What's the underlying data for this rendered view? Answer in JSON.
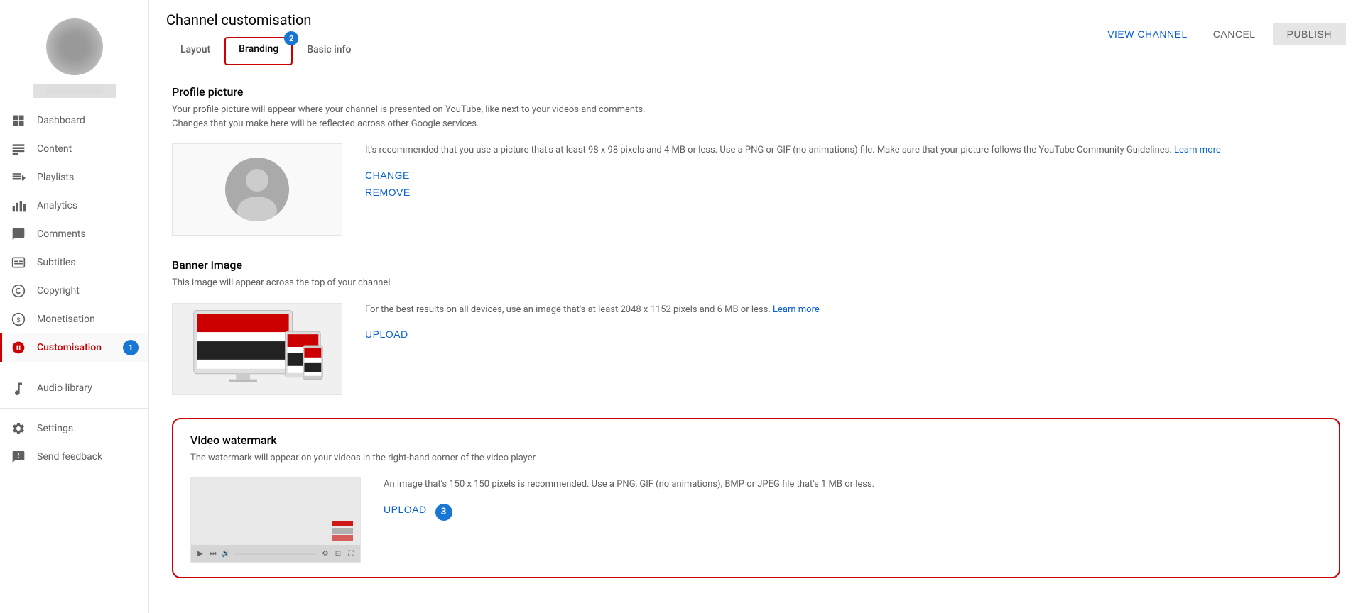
{
  "sidebar": {
    "avatar_name": "",
    "nav_items": [
      {
        "id": "dashboard",
        "label": "Dashboard",
        "icon": "dashboard",
        "active": false
      },
      {
        "id": "content",
        "label": "Content",
        "icon": "content",
        "active": false
      },
      {
        "id": "playlists",
        "label": "Playlists",
        "icon": "playlists",
        "active": false
      },
      {
        "id": "analytics",
        "label": "Analytics",
        "icon": "analytics",
        "active": false
      },
      {
        "id": "comments",
        "label": "Comments",
        "icon": "comments",
        "active": false
      },
      {
        "id": "subtitles",
        "label": "Subtitles",
        "icon": "subtitles",
        "active": false
      },
      {
        "id": "copyright",
        "label": "Copyright",
        "icon": "copyright",
        "active": false
      },
      {
        "id": "monetisation",
        "label": "Monetisation",
        "icon": "monetisation",
        "active": false
      },
      {
        "id": "customisation",
        "label": "Customisation",
        "icon": "customisation",
        "active": true
      }
    ],
    "bottom_items": [
      {
        "id": "audio-library",
        "label": "Audio library",
        "icon": "audio"
      },
      {
        "id": "settings",
        "label": "Settings",
        "icon": "settings"
      },
      {
        "id": "send-feedback",
        "label": "Send feedback",
        "icon": "feedback"
      }
    ]
  },
  "page": {
    "title": "Channel customisation",
    "tabs": [
      {
        "id": "layout",
        "label": "Layout",
        "active": false
      },
      {
        "id": "branding",
        "label": "Branding",
        "active": true
      },
      {
        "id": "basic-info",
        "label": "Basic info",
        "active": false
      }
    ],
    "actions": {
      "view_channel": "VIEW CHANNEL",
      "cancel": "CANCEL",
      "publish": "PUBLISH"
    }
  },
  "sections": {
    "profile_picture": {
      "title": "Profile picture",
      "description": "Your profile picture will appear where your channel is presented on YouTube, like next to your videos and comments. Changes that you make here will be reflected across other Google services.",
      "info": "It's recommended that you use a picture that's at least 98 x 98 pixels and 4 MB or less. Use a PNG or GIF (no animations) file. Make sure that your picture follows the YouTube Community Guidelines.",
      "learn_more_label": "Learn more",
      "change_label": "CHANGE",
      "remove_label": "REMOVE"
    },
    "banner_image": {
      "title": "Banner image",
      "description": "This image will appear across the top of your channel",
      "info": "For the best results on all devices, use an image that's at least 2048 x 1152 pixels and 6 MB or less.",
      "learn_more_label": "Learn more",
      "upload_label": "UPLOAD"
    },
    "video_watermark": {
      "title": "Video watermark",
      "description": "The watermark will appear on your videos in the right-hand corner of the video player",
      "info": "An image that's 150 x 150 pixels is recommended. Use a PNG, GIF (no animations), BMP or JPEG file that's 1 MB or less.",
      "upload_label": "UPLOAD"
    }
  },
  "badges": {
    "branding_tab": "2",
    "customisation_nav": "1",
    "watermark_section": "3"
  },
  "colors": {
    "primary_red": "#cc0000",
    "primary_blue": "#065fd4",
    "active_nav_red": "#cc0000"
  }
}
